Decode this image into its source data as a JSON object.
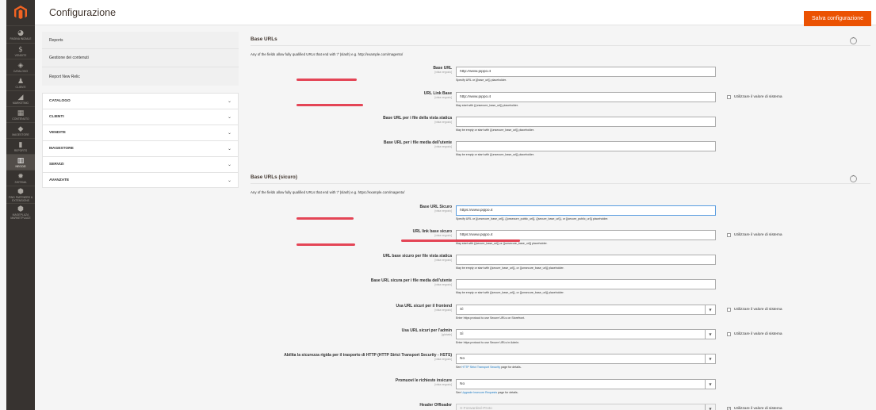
{
  "menu": [
    {
      "name": "dashboard",
      "icon": "gauge-icon",
      "glyph": "◕",
      "label": "PAGINA INIZIALE"
    },
    {
      "name": "sales",
      "icon": "dollar-icon",
      "glyph": "$",
      "label": "VENDITE"
    },
    {
      "name": "catalog",
      "icon": "cube-icon",
      "glyph": "◈",
      "label": "CATALOGO"
    },
    {
      "name": "customers",
      "icon": "person-icon",
      "glyph": "♟",
      "label": "CLIENTI"
    },
    {
      "name": "marketing",
      "icon": "megaphone-icon",
      "glyph": "◢",
      "label": "MARKETING"
    },
    {
      "name": "content",
      "icon": "layout-icon",
      "glyph": "▦",
      "label": "CONTENUTO"
    },
    {
      "name": "magestore",
      "icon": "magestore-icon",
      "glyph": "◆",
      "label": "MAGESTORE"
    },
    {
      "name": "reports",
      "icon": "bar-chart-icon",
      "glyph": "▮",
      "label": "REPORTS"
    },
    {
      "name": "stores",
      "icon": "store-icon",
      "glyph": "▥",
      "label": "NEGOZI",
      "active": true
    },
    {
      "name": "system",
      "icon": "gear-icon",
      "glyph": "✹",
      "label": "SISTEMA"
    },
    {
      "name": "partners",
      "icon": "box-icon",
      "glyph": "⬢",
      "label": "FIND PARTNERS & EXTENSIONS"
    },
    {
      "name": "marketplace",
      "icon": "marketplace-icon",
      "glyph": "⬢",
      "label": "MAGEPLAZA MARKETPLACE"
    }
  ],
  "header": {
    "title": "Configurazione",
    "save_label": "Salva configurazione"
  },
  "tabs": {
    "links": [
      "Reports",
      "Gestione dei contenuti",
      "Report New Relic"
    ],
    "groups": [
      "CATALOGO",
      "CLIENTI",
      "VENDITE",
      "MAGESTORE",
      "SERVIZI",
      "AVANZATE"
    ]
  },
  "base_urls": {
    "title": "Base URLs",
    "note": "Any of the fields allow fully qualified URLs that end with '/' (slash) e.g. http://example.com/magento/",
    "fields": [
      {
        "label": "Base URL",
        "scope": "[vista negozio]",
        "value": "http://www.pippo.it",
        "note": "Specify URL or {{base_url}} placeholder."
      },
      {
        "label": "URL Link Base",
        "scope": "[vista negozio]",
        "value": "http://www.pippo.it",
        "note": "May start with {{unsecure_base_url}} placeholder.",
        "system": "Utilizzare il valore di sistema"
      },
      {
        "label": "Base URL per i file della vista statica",
        "scope": "[vista negozio]",
        "value": "",
        "note": "May be empty or start with {{unsecure_base_url}} placeholder."
      },
      {
        "label": "Base URL per i file media dell'utente",
        "scope": "[vista negozio]",
        "value": "",
        "note": "May be empty or start with {{unsecure_base_url}} placeholder."
      }
    ]
  },
  "base_urls_secure": {
    "title": "Base URLs (sicuro)",
    "note": "Any of the fields allow fully qualified URLs that end with '/' (slash) e.g. https://example.com/magento/",
    "fields": [
      {
        "label": "Base URL Sicuro",
        "scope": "[vista negozio]",
        "value": "https://www.pippo.it",
        "note": "Specify URL or {{unsecure_base_url}}, {{unsecure_public_url}}, {{secure_base_url}}, or {{secure_public_url}} placeholder."
      },
      {
        "label": "URL link base sicuro",
        "scope": "[vista negozio]",
        "value": "https://www.pippo.it",
        "note": "May start with {{secure_base_url}} or {{unsecure_base_url}} placeholder.",
        "system": "Utilizzare il valore di sistema"
      },
      {
        "label": "URL base sicuro per file vista statica",
        "scope": "[vista negozio]",
        "value": "",
        "note": "May be empty or start with {{secure_base_url}}, or {{unsecure_base_url}} placeholder."
      },
      {
        "label": "Base URL sicura per i file media dell'utente",
        "scope": "[vista negozio]",
        "value": "",
        "note": "May be empty or start with {{secure_base_url}}, or {{unsecure_base_url}} placeholder."
      }
    ],
    "selects": [
      {
        "label": "Usa URL sicuri per il frontend",
        "scope": "[vista negozio]",
        "value": "Sì",
        "note": "Enter https protocol to use Secure URLs on Storefront.",
        "system": "Utilizzare il valore di sistema"
      },
      {
        "label": "Usa URL sicuri per l'admin",
        "scope": "[globale]",
        "value": "Sì",
        "note": "Enter https protocol to use Secure URLs in Admin.",
        "system": "Utilizzare il valore di sistema"
      },
      {
        "label": "Abilita la sicurezza rigida per il trasporto di HTTP (HTTP Strict Transport Security - HSTS)",
        "scope": "[vista negozio]",
        "value": "No",
        "note_pre": "See ",
        "note_link": "HTTP Strict Transport Security",
        "note_post": " page for details."
      },
      {
        "label": "Promuovi le richieste insicure",
        "scope": "[vista negozio]",
        "value": "No",
        "note_pre": "See ",
        "note_link": "Upgrade Insecure Requests",
        "note_post": " page for details."
      },
      {
        "label": "Header Offloader",
        "scope": "",
        "value": "X-Forwarded-Proto",
        "system": "Utilizzare il valore di sistema",
        "system_checked": true
      }
    ]
  }
}
